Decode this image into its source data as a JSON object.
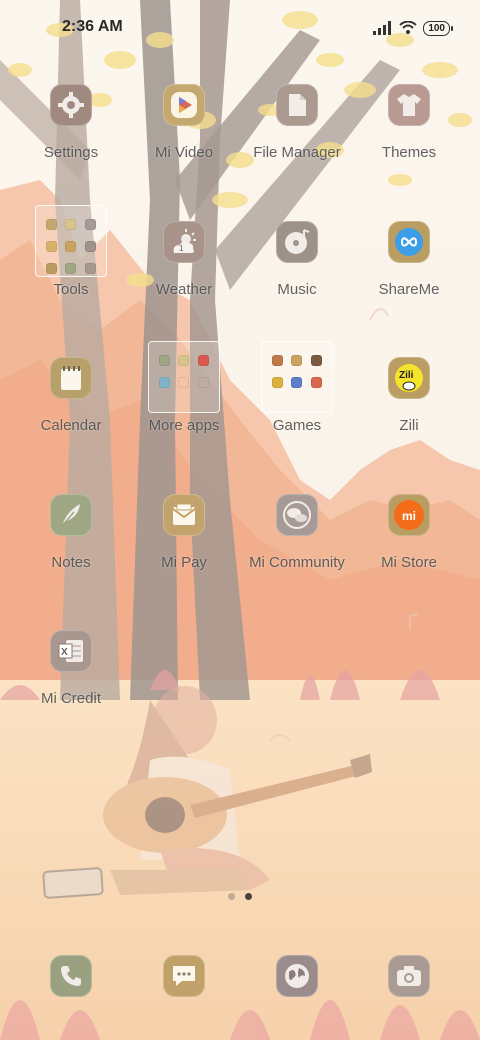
{
  "status": {
    "time": "2:36 AM",
    "battery": "100"
  },
  "apps": [
    {
      "label": "Settings",
      "icon": "gear-icon",
      "color": "#a08a80"
    },
    {
      "label": "Mi Video",
      "icon": "play-icon",
      "color": "#c4a870"
    },
    {
      "label": "File Manager",
      "icon": "file-icon",
      "color": "#ac9a90"
    },
    {
      "label": "Themes",
      "icon": "tshirt-icon",
      "color": "#b89a92"
    },
    {
      "label": "Tools",
      "icon": "folder-icon"
    },
    {
      "label": "Weather",
      "icon": "weather-icon",
      "color": "#a8938b"
    },
    {
      "label": "Music",
      "icon": "music-disc-icon",
      "color": "#9e918a"
    },
    {
      "label": "ShareMe",
      "icon": "infinity-icon",
      "color": "#b99d62"
    },
    {
      "label": "Calendar",
      "icon": "notepad-icon",
      "color": "#b7a06a"
    },
    {
      "label": "More apps",
      "icon": "folder-icon"
    },
    {
      "label": "Games",
      "icon": "folder-icon"
    },
    {
      "label": "Zili",
      "icon": "zili-icon",
      "color": "#b99d62"
    },
    {
      "label": "Notes",
      "icon": "feather-icon",
      "color": "#9ea683"
    },
    {
      "label": "Mi Pay",
      "icon": "wallet-icon",
      "color": "#c2a36b"
    },
    {
      "label": "Mi Community",
      "icon": "chat-bubbles-icon",
      "color": "#a79a96"
    },
    {
      "label": "Mi Store",
      "icon": "mi-logo-icon",
      "color": "#b99d62"
    },
    {
      "label": "Mi Credit",
      "icon": "spreadsheet-icon",
      "color": "#a8978f"
    }
  ],
  "dock": [
    {
      "name": "phone",
      "icon": "phone-icon",
      "color": "#9aa180"
    },
    {
      "name": "messages",
      "icon": "message-icon",
      "color": "#c0a16a"
    },
    {
      "name": "browser",
      "icon": "globe-icon",
      "color": "#9a8c8c"
    },
    {
      "name": "camera",
      "icon": "camera-icon",
      "color": "#a99a94"
    }
  ],
  "pages": {
    "count": 2,
    "active": 2
  }
}
